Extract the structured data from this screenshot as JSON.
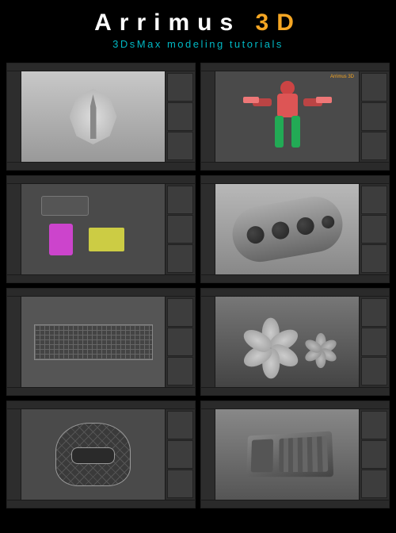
{
  "header": {
    "title_main": "Arrimus",
    "title_accent": "3D",
    "subtitle": "3DsMax modeling tutorials"
  },
  "thumbnails": [
    {
      "name": "shield-emblem",
      "viewport": "light"
    },
    {
      "name": "character-rig",
      "viewport": "dark",
      "watermark": "Arrimus 3D"
    },
    {
      "name": "primitives-gun",
      "viewport": "dark"
    },
    {
      "name": "cylinder-holes",
      "viewport": "light2"
    },
    {
      "name": "rifle-wireframe",
      "viewport": "wire"
    },
    {
      "name": "flower-model",
      "viewport": "gradient"
    },
    {
      "name": "helmet-wireframe",
      "viewport": "dark"
    },
    {
      "name": "crate-model",
      "viewport": "gradient2"
    }
  ]
}
